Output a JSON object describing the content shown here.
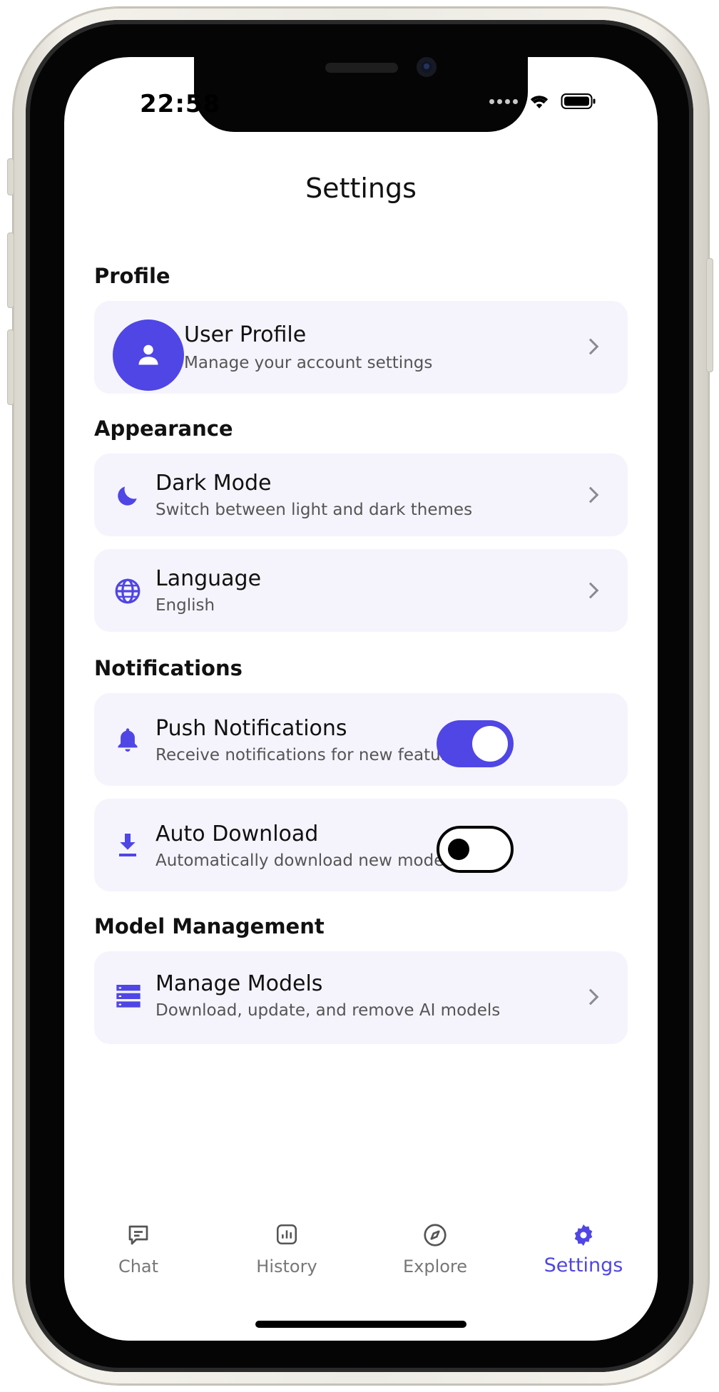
{
  "status_bar": {
    "time": "22:58"
  },
  "header": {
    "title": "Settings"
  },
  "sections": {
    "profile": "Profile",
    "appearance": "Appearance",
    "notifications": "Notifications",
    "model_management": "Model Management"
  },
  "profile_card": {
    "title": "User Profile",
    "subtitle": "Manage your account settings",
    "icon": "person-icon"
  },
  "dark_mode": {
    "title": "Dark Mode",
    "subtitle": "Switch between light and dark themes",
    "icon": "moon-icon"
  },
  "language": {
    "title": "Language",
    "subtitle": "English",
    "icon": "globe-icon"
  },
  "push_notifications": {
    "title": "Push Notifications",
    "subtitle": "Receive notifications for new features",
    "enabled": true,
    "icon": "bell-icon"
  },
  "auto_download": {
    "title": "Auto Download",
    "subtitle": "Automatically download new models",
    "enabled": false,
    "icon": "download-icon"
  },
  "manage_models": {
    "title": "Manage Models",
    "subtitle": "Download, update, and remove AI models",
    "icon": "server-icon"
  },
  "tab_bar": {
    "tabs": [
      {
        "label": "Chat",
        "icon": "chat-icon",
        "active": false
      },
      {
        "label": "History",
        "icon": "chart-icon",
        "active": false
      },
      {
        "label": "Explore",
        "icon": "compass-icon",
        "active": false
      },
      {
        "label": "Settings",
        "icon": "gear-icon",
        "active": true
      }
    ]
  },
  "colors": {
    "accent": "#4f46e5",
    "card_bg": "#f5f4fd",
    "text_primary": "#111111",
    "text_secondary": "#555555",
    "tab_inactive": "#777777"
  }
}
